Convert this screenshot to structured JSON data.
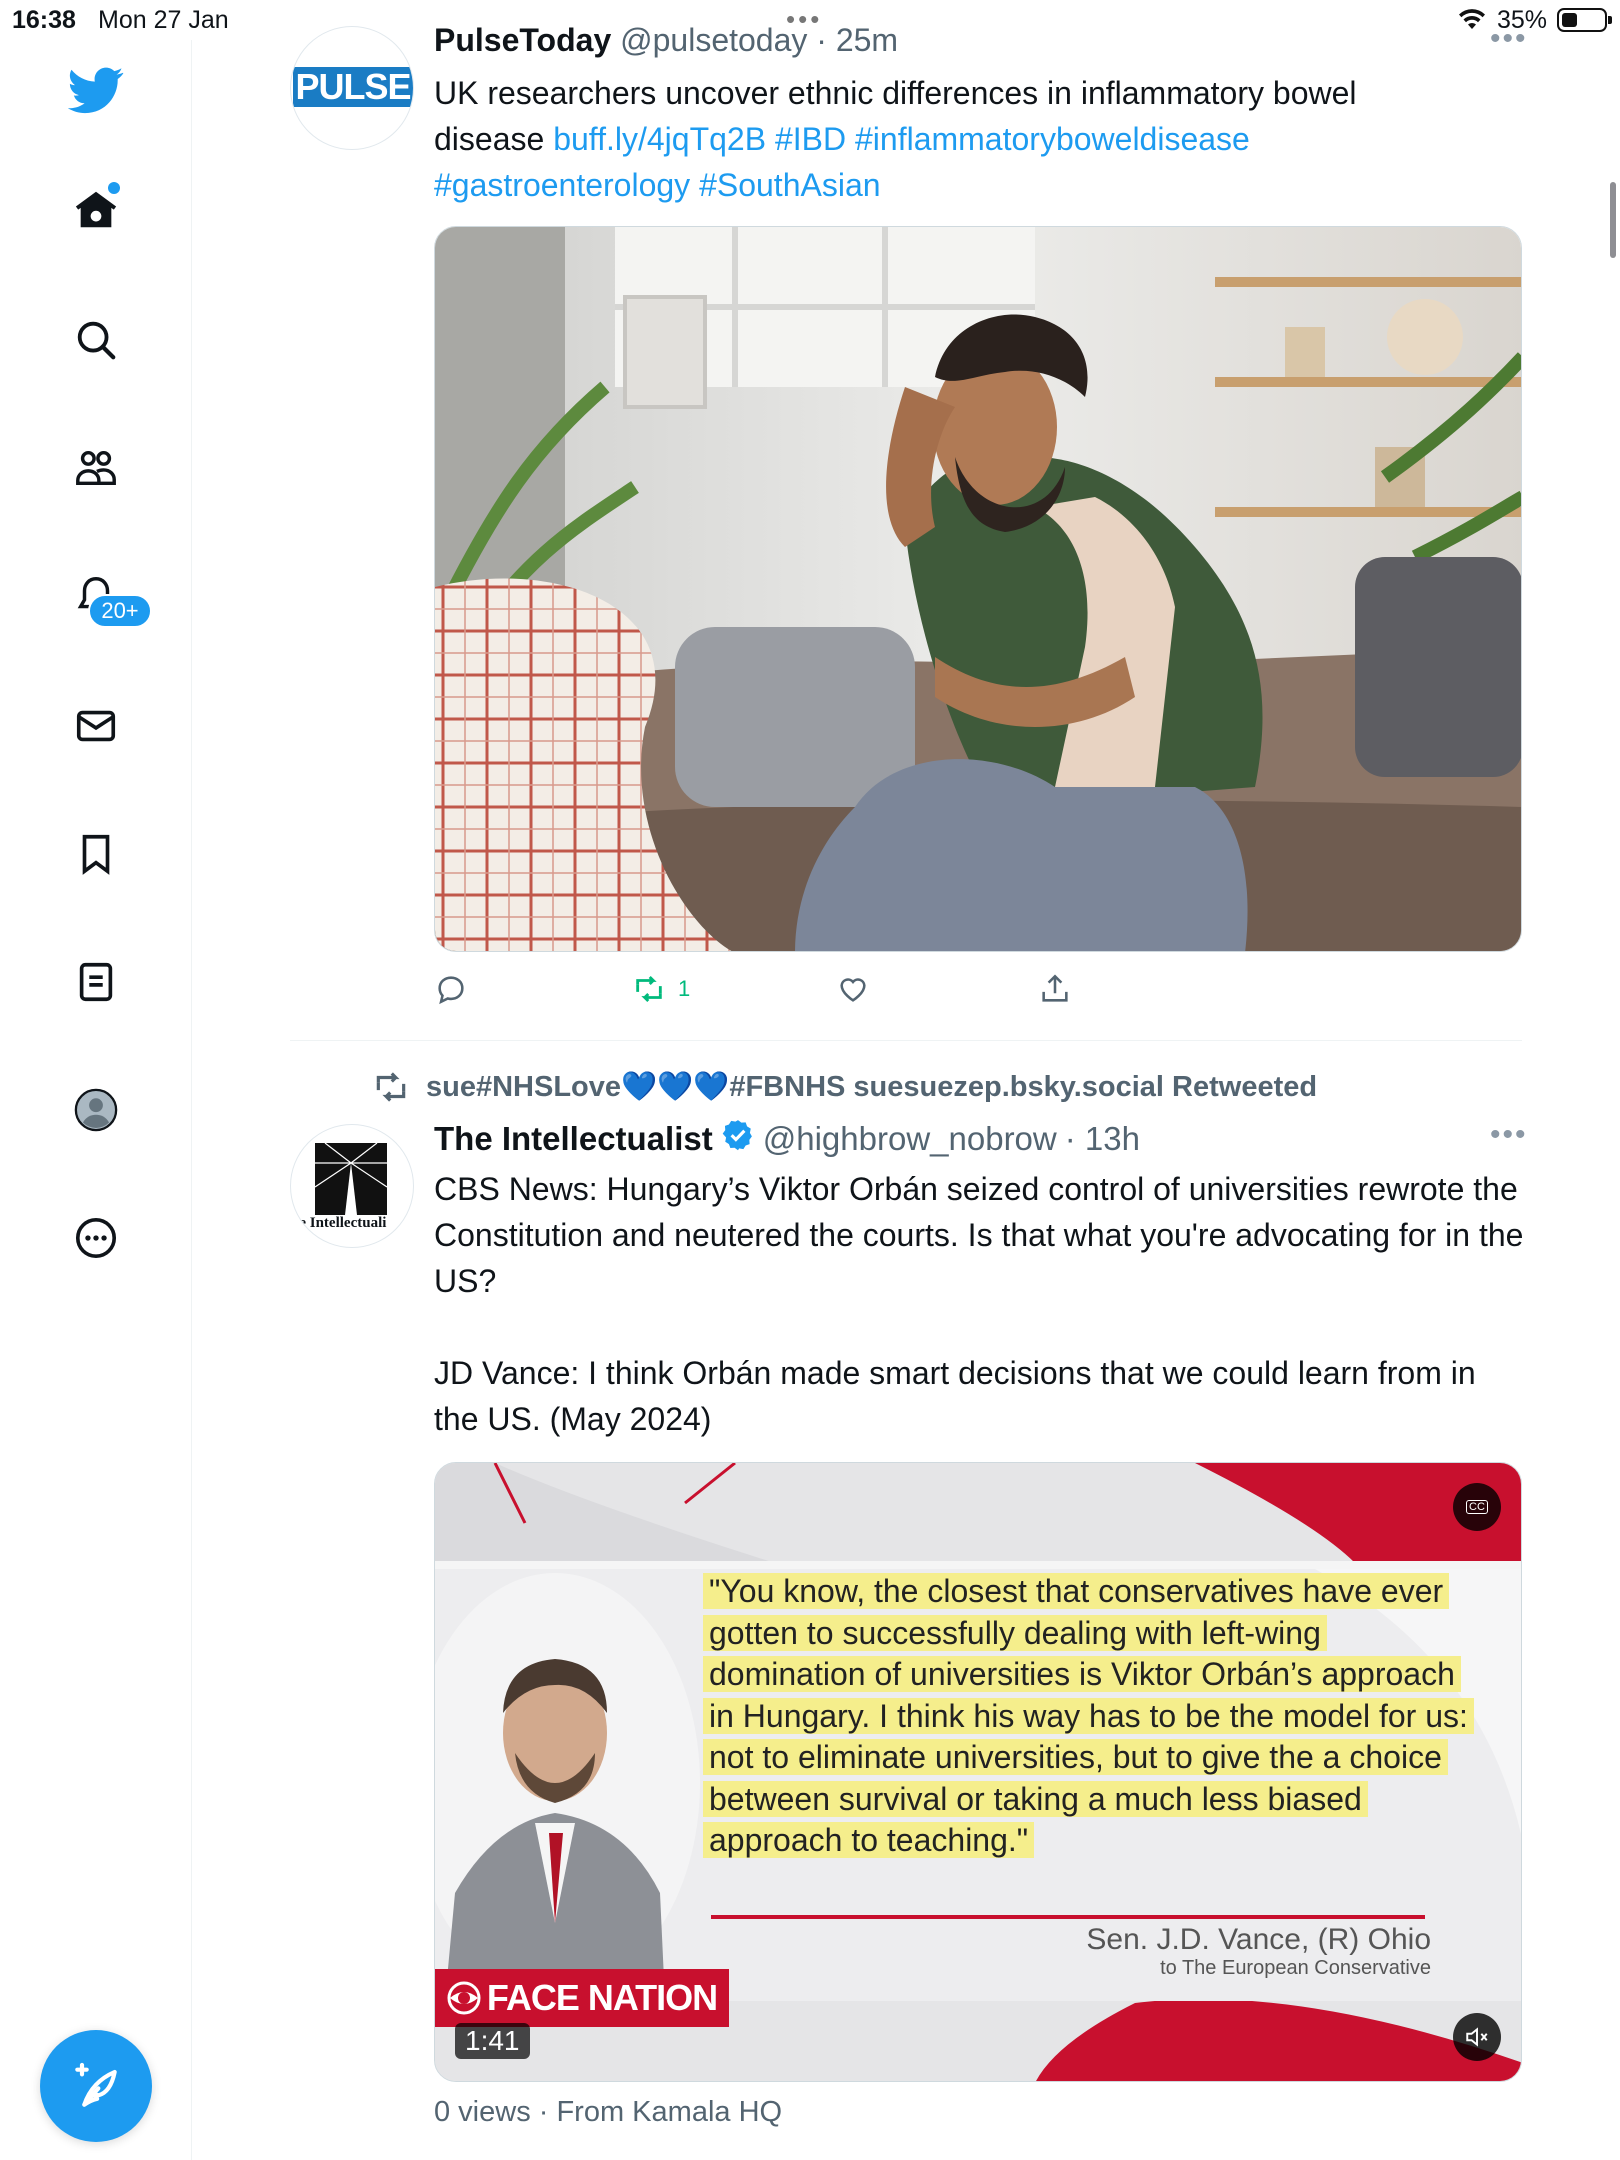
{
  "status_bar": {
    "time": "16:38",
    "date": "Mon 27 Jan",
    "battery": "35%"
  },
  "sidebar": {
    "items": [
      {
        "name": "twitter-logo",
        "icon": "bird-icon"
      },
      {
        "name": "home",
        "icon": "home-icon"
      },
      {
        "name": "explore",
        "icon": "search-icon"
      },
      {
        "name": "communities",
        "icon": "people-icon"
      },
      {
        "name": "notifications",
        "icon": "bell-icon",
        "badge": "20+"
      },
      {
        "name": "messages",
        "icon": "envelope-icon"
      },
      {
        "name": "bookmarks",
        "icon": "bookmark-icon"
      },
      {
        "name": "lists",
        "icon": "list-icon"
      },
      {
        "name": "profile",
        "icon": "avatar-icon"
      },
      {
        "name": "more",
        "icon": "more-icon"
      }
    ],
    "notif_badge": "20+"
  },
  "tweet1": {
    "author_name": "PulseToday",
    "handle": "@pulsetoday",
    "time": "· 25m",
    "avatar_text": "PULSE",
    "text_plain": "UK researchers uncover ethnic differences in inflammatory bowel disease",
    "link": "buff.ly/4jqTq2B",
    "hashtag1": "#IBD",
    "hashtag2": "#inflammatoryboweldisease",
    "hashtag3": "#gastroenterology",
    "hashtag4": "#SouthAsian",
    "retweet_count": "1"
  },
  "retweet_banner": {
    "text": "sue#NHSLove💙💙💙#FBNHS suesuezep.bsky.social Retweeted"
  },
  "tweet2": {
    "author_name": "The Intellectualist",
    "handle": "@highbrow_nobrow",
    "time": "· 13h",
    "avatar_text": "he Intellectuali",
    "para1": "CBS News: Hungary’s Viktor Orbán seized control of universities rewrote the Constitution and neutered the courts. Is that what you're advocating for in the US?",
    "para2": "JD Vance: I think Orbán made smart decisions that we could learn from in the US. (May 2024)",
    "video": {
      "quote": "\"You know, the closest that conservatives have ever gotten to successfully dealing with left-wing domination of universities is Viktor Orbán’s approach in Hungary. I think his way has to be the model for us: not to eliminate universities, but to give the a choice between survival or taking a much less biased approach to teaching.\"",
      "attribution": "Sen. J.D. Vance, (R) Ohio",
      "attribution_sub": "to The European Conservative",
      "brand": "FACE NATION",
      "duration": "1:41",
      "cc_label": "CC"
    },
    "footer": "0 views · From Kamala HQ"
  },
  "colors": {
    "accent": "#1d9bf0",
    "retweet_green": "#00ba7c",
    "secondary_text": "#536471",
    "cbs_red": "#c8102e"
  }
}
